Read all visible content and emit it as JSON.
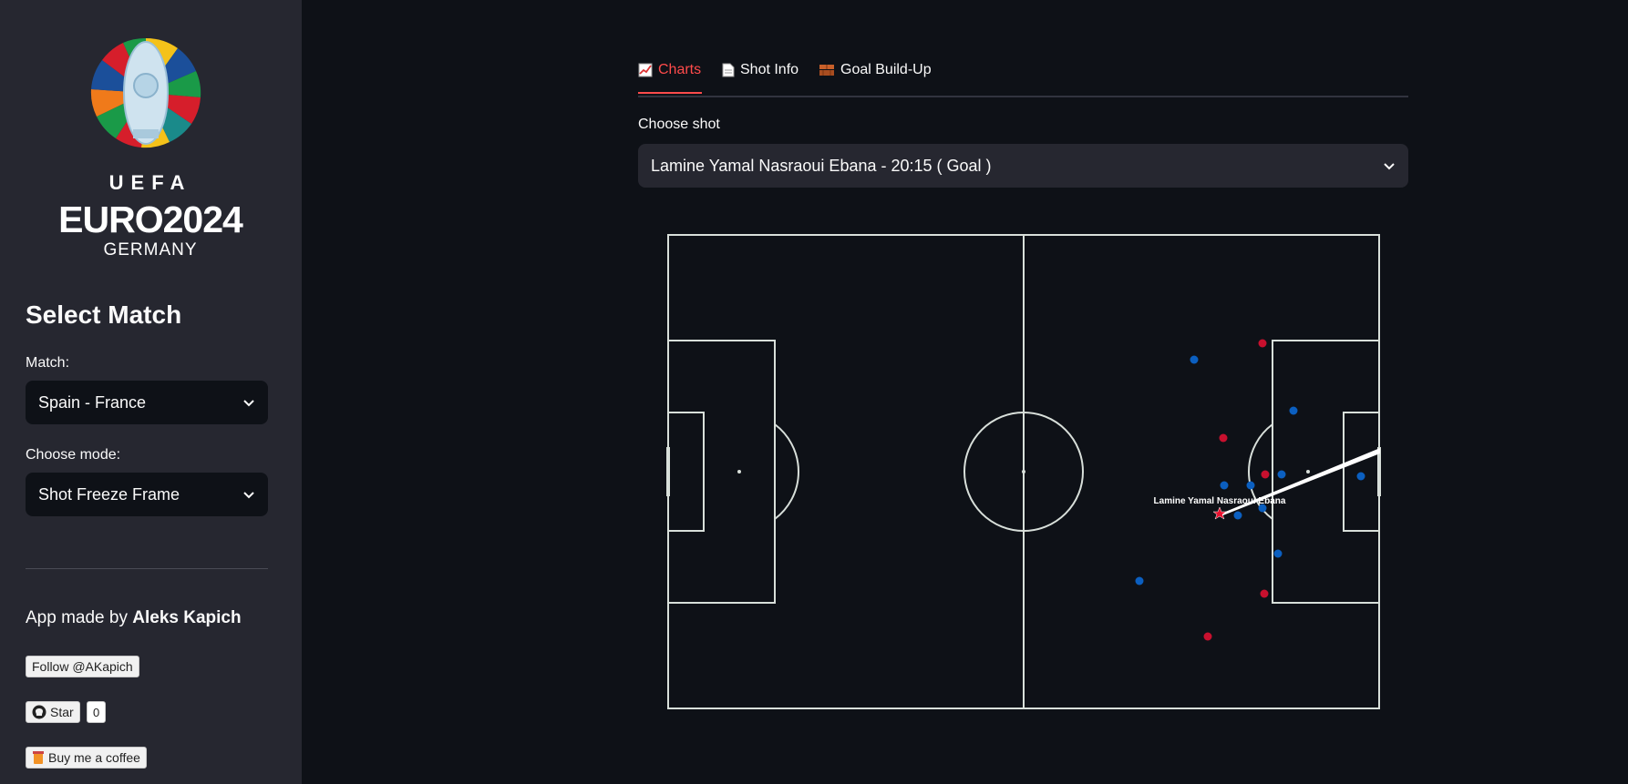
{
  "sidebar": {
    "logo": {
      "uefa": "UEFA",
      "euro": "EURO2024",
      "country": "GERMANY"
    },
    "heading": "Select Match",
    "match_label": "Match:",
    "match_value": "Spain - France",
    "mode_label": "Choose mode:",
    "mode_value": "Shot Freeze Frame",
    "credit_prefix": "App made by",
    "credit_name": "Aleks Kapich",
    "follow_label": "Follow @AKapich",
    "star_label": "Star",
    "star_count": "0",
    "coffee_label": "Buy me a coffee"
  },
  "tabs": [
    {
      "label": "Charts",
      "icon": "chart-icon",
      "active": true
    },
    {
      "label": "Shot Info",
      "icon": "document-icon",
      "active": false
    },
    {
      "label": "Goal Build-Up",
      "icon": "bricks-icon",
      "active": false
    }
  ],
  "shot_select": {
    "label": "Choose shot",
    "value": "Lamine Yamal Nasraoui Ebana - 20:15 ( Goal )"
  },
  "freeze_frame": {
    "shooter_label": "Lamine Yamal Nasraoui Ebana",
    "colors": {
      "teammate": "#c8102e",
      "opponent": "#0b5fc0",
      "shooter": "#e8102e",
      "lines": "#d8dfda"
    }
  }
}
